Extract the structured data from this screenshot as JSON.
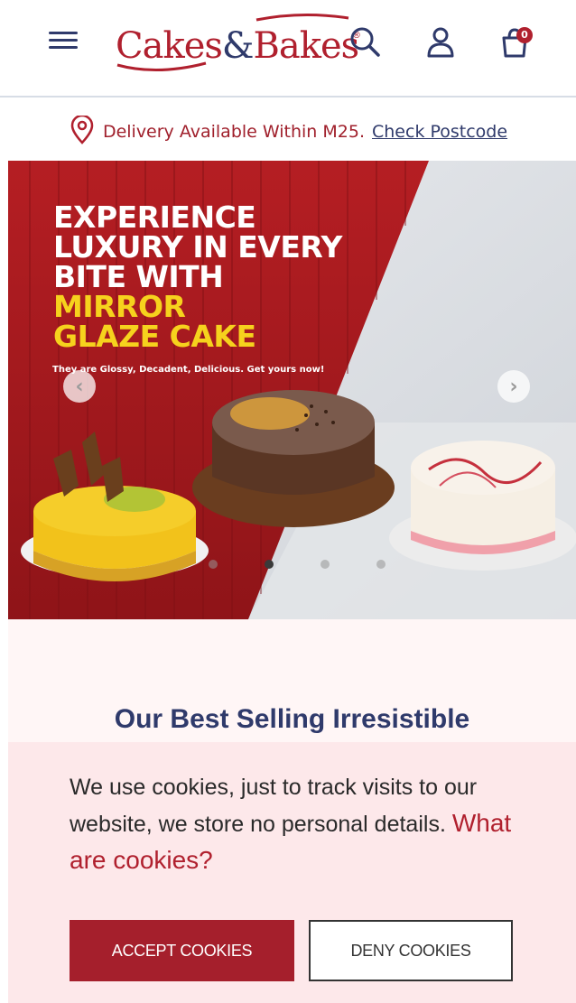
{
  "header": {
    "logo": {
      "word1": "Cakes",
      "amp": "&",
      "word2": "Bakes",
      "reg": "®"
    },
    "icons": [
      "menu-icon",
      "search-icon",
      "user-icon",
      "cart-icon"
    ],
    "cart_count": "0"
  },
  "delivery": {
    "text": "Delivery Available Within M25.",
    "link": "Check Postcode"
  },
  "hero": {
    "headline": [
      "EXPERIENCE",
      "LUXURY IN EVERY",
      "BITE WITH"
    ],
    "highlight": [
      "MIRROR",
      "GLAZE CAKE"
    ],
    "tagline": "They are Glossy, Decadent, Delicious. Get yours now!",
    "prev_arrow": "‹",
    "next_arrow": "›",
    "slide_count": 4,
    "active_slide": 1
  },
  "section": {
    "title": "Our Best Selling Irresistible"
  },
  "cookie": {
    "text": "We use cookies, just to track visits to our website, we store no personal details.",
    "link": "What are cookies?",
    "accept_label": "ACCEPT COOKIES",
    "deny_label": "DENY COOKIES"
  },
  "colors": {
    "brand_red": "#b0202e",
    "brand_navy": "#2f3a6b",
    "highlight_yellow": "#f6d21d",
    "cookie_bg": "#fde8ea"
  }
}
